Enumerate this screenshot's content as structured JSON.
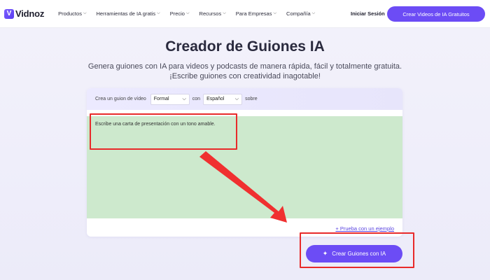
{
  "brand": {
    "name": "Vidnoz",
    "logo_letter": "V",
    "accent": "#6c4cf5"
  },
  "nav": [
    {
      "label": "Productos",
      "has_dropdown": true
    },
    {
      "label": "Herramientas de IA gratis",
      "has_dropdown": true
    },
    {
      "label": "Precio",
      "has_dropdown": true
    },
    {
      "label": "Recursos",
      "has_dropdown": true
    },
    {
      "label": "Para Empresas",
      "has_dropdown": true
    },
    {
      "label": "Compañía",
      "has_dropdown": true
    }
  ],
  "header": {
    "login_label": "Iniciar Sesión",
    "cta_label": "Crear Videos de IA Gratuitos"
  },
  "hero": {
    "title": "Creador de Guiones IA",
    "subtitle_line1": "Genera guiones con IA para videos y podcasts de manera rápida, fácil y totalmente gratuita.",
    "subtitle_line2": "¡Escribe guiones con creatividad inagotable!"
  },
  "form": {
    "prefix": "Crea un guion de vídeo",
    "tone_value": "Formal",
    "connector": "con",
    "language_value": "Español",
    "suffix": "sobre",
    "textarea_placeholder": "Escribe una carta de presentación con un tono amable.",
    "example_link": "+ Prueba con un ejemplo",
    "generate_label": "Crear Guiones con IA",
    "textarea_color": "#cde9cd"
  },
  "annotations": {
    "highlight_color": "#e82a2a"
  }
}
